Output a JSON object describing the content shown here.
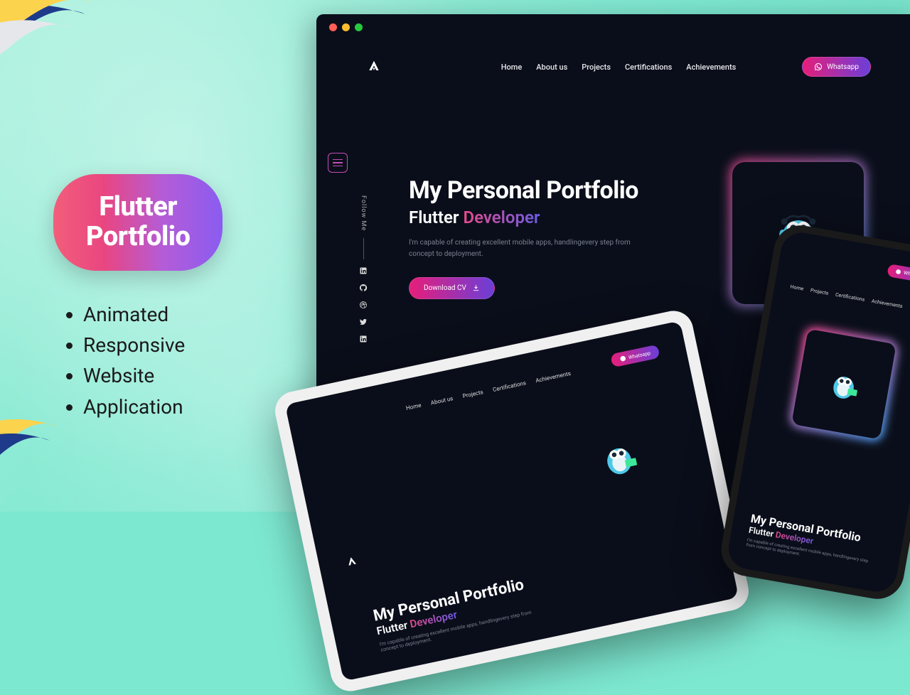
{
  "promo": {
    "title_line1": "Flutter",
    "title_line2": "Portfolio",
    "features": [
      "Animated",
      "Responsive",
      "Website",
      "Application"
    ]
  },
  "nav": {
    "items": [
      "Home",
      "About us",
      "Projects",
      "Certifications",
      "Achievements"
    ]
  },
  "whatsapp": {
    "label": "Whatsapp"
  },
  "follow": {
    "label": "Follow Me",
    "icons": [
      "linkedin-icon",
      "github-icon",
      "dribbble-icon",
      "twitter-icon",
      "linkedin-icon"
    ]
  },
  "hero": {
    "title": "My Personal Portfolio",
    "subtitle_prefix": "Flutter ",
    "subtitle_accent": "Developer",
    "description": "I'm capable of creating excellent mobile apps, handlingevery step from concept to deployment.",
    "download_label": "Download CV"
  },
  "colors": {
    "gradient_pink": "#e61e7a",
    "gradient_purple": "#6b3fd8",
    "bg_dark": "#0a0e1a"
  }
}
